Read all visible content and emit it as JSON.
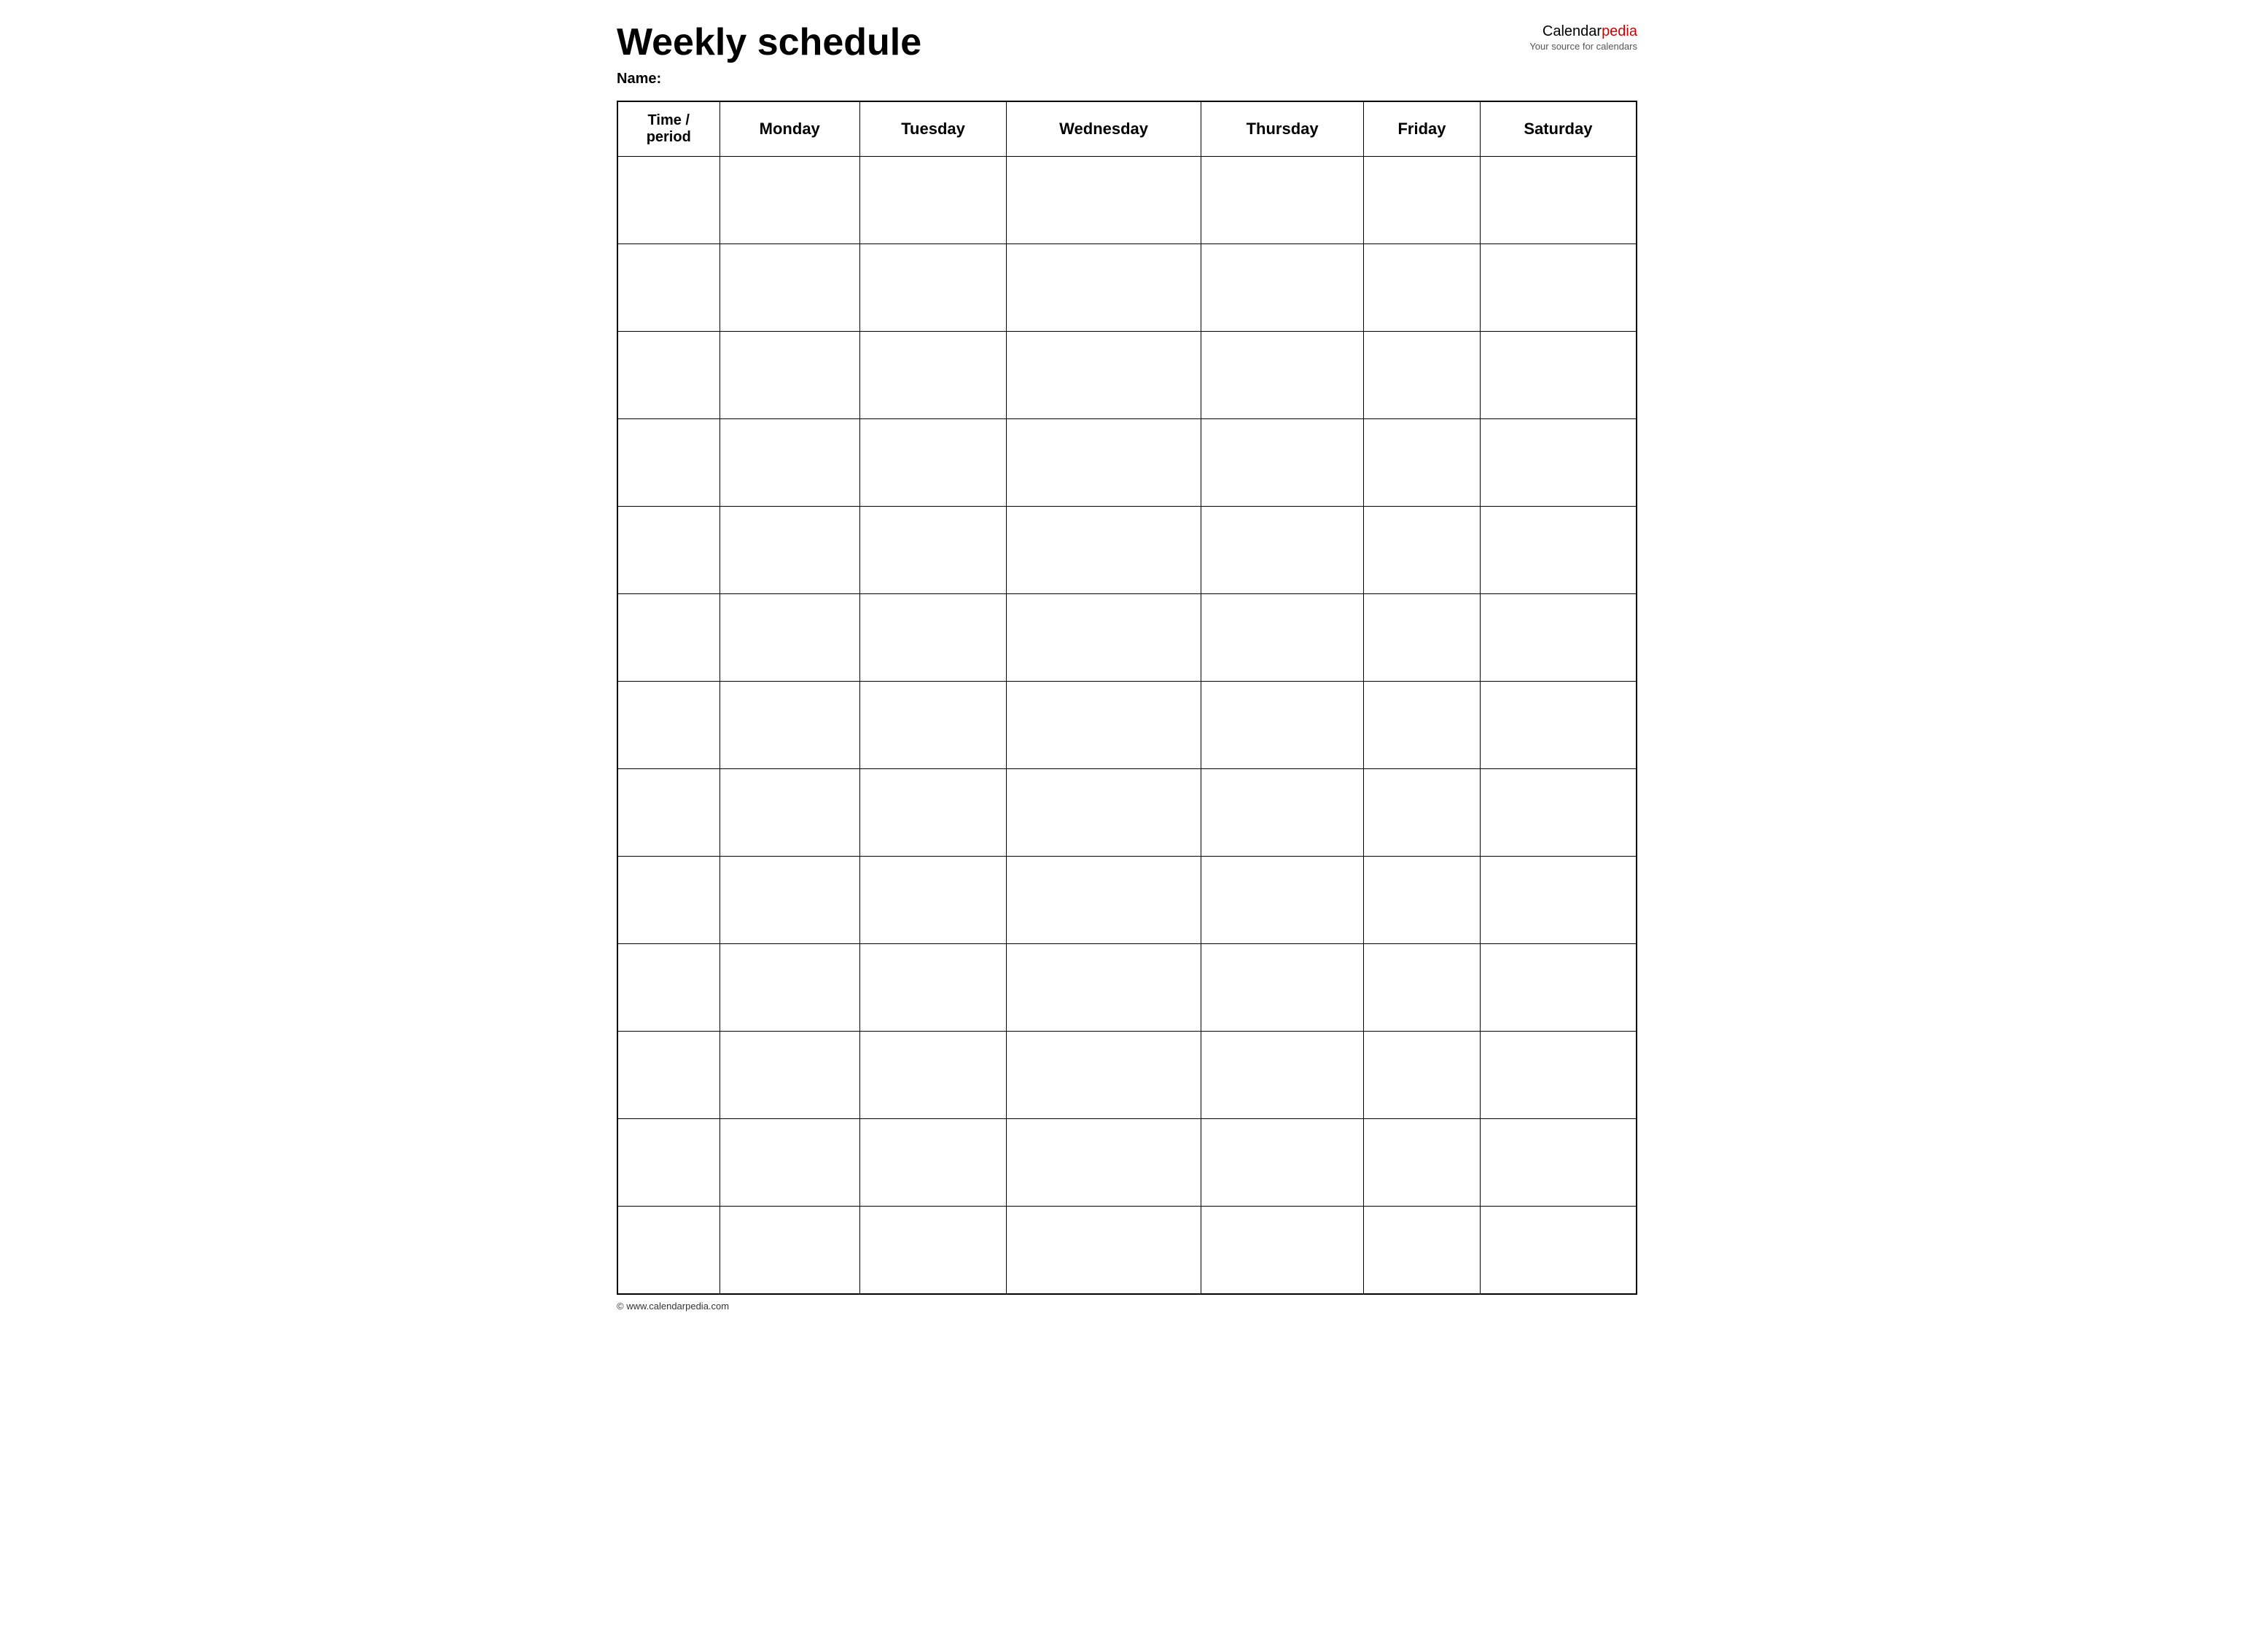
{
  "header": {
    "title": "Weekly schedule",
    "logo": {
      "text_black": "Calendar",
      "text_red": "pedia",
      "subtitle": "Your source for calendars"
    },
    "name_label": "Name:"
  },
  "table": {
    "columns": [
      {
        "key": "time",
        "label": "Time / period"
      },
      {
        "key": "monday",
        "label": "Monday"
      },
      {
        "key": "tuesday",
        "label": "Tuesday"
      },
      {
        "key": "wednesday",
        "label": "Wednesday"
      },
      {
        "key": "thursday",
        "label": "Thursday"
      },
      {
        "key": "friday",
        "label": "Friday"
      },
      {
        "key": "saturday",
        "label": "Saturday"
      }
    ],
    "row_count": 13
  },
  "footer": {
    "text": "© www.calendarpedia.com"
  }
}
